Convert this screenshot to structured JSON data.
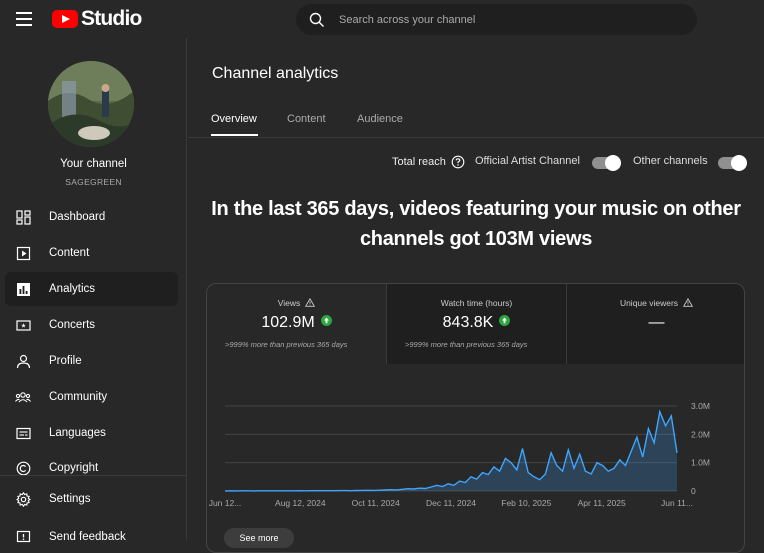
{
  "app": {
    "logo_text": "Studio"
  },
  "search": {
    "placeholder": "Search across your channel"
  },
  "channel": {
    "name": "Your channel",
    "handle": "SAGEGREEN"
  },
  "sidebar": {
    "items": [
      {
        "label": "Dashboard",
        "icon": "dashboard-icon"
      },
      {
        "label": "Content",
        "icon": "content-icon"
      },
      {
        "label": "Analytics",
        "icon": "analytics-icon",
        "active": true
      },
      {
        "label": "Concerts",
        "icon": "ticket-icon"
      },
      {
        "label": "Profile",
        "icon": "profile-icon"
      },
      {
        "label": "Community",
        "icon": "community-icon"
      },
      {
        "label": "Languages",
        "icon": "subtitles-icon"
      },
      {
        "label": "Copyright",
        "icon": "copyright-icon"
      }
    ],
    "settings": "Settings",
    "feedback": "Send feedback"
  },
  "main": {
    "title": "Channel analytics",
    "tabs": [
      "Overview",
      "Content",
      "Audience"
    ],
    "active_tab": "Overview",
    "reach": {
      "label": "Total reach",
      "official": "Official Artist Channel",
      "official_on": true,
      "other": "Other channels",
      "other_on": true
    },
    "headline": "In the last 365 days, videos featuring your music on other channels got 103M views",
    "metrics": [
      {
        "title": "Views",
        "value": "102.9M",
        "trend": "up",
        "sub": ">999% more than previous 365 days"
      },
      {
        "title": "Watch time (hours)",
        "value": "843.8K",
        "trend": "up",
        "sub": ">999% more than previous 365 days"
      },
      {
        "title": "Unique viewers",
        "value": "—"
      }
    ],
    "see_more": "See more"
  },
  "colors": {
    "accent": "#ff0000",
    "line": "#3ea6ff",
    "positive": "#2ba640"
  },
  "chart_data": {
    "type": "line",
    "x_tick_labels": [
      "Jun 12...",
      "Aug 12, 2024",
      "Oct 11, 2024",
      "Dec 11, 2024",
      "Feb 10, 2025",
      "Apr 11, 2025",
      "Jun 11..."
    ],
    "y_tick_labels": [
      "3.0M",
      "2.0M",
      "1.0M",
      "0"
    ],
    "ylim": [
      0,
      3000000
    ],
    "series": [
      {
        "values": [
          5000,
          6000,
          5000,
          7000,
          6000,
          5000,
          6000,
          7000,
          8000,
          6000,
          7000,
          8000,
          7000,
          9000,
          8000,
          10000,
          9000,
          11000,
          12000,
          10000,
          13000,
          15000,
          12000,
          18000,
          20000,
          25000,
          22000,
          30000,
          35000,
          45000,
          40000,
          60000,
          80000,
          70000,
          100000,
          90000,
          140000,
          200000,
          160000,
          250000,
          200000,
          350000,
          300000,
          500000,
          420000,
          650000,
          580000,
          850000,
          700000,
          1150000,
          1000000,
          750000,
          1500000,
          650000,
          500000,
          400000,
          600000,
          1350000,
          900000,
          700000,
          1450000,
          800000,
          1300000,
          700000,
          600000,
          1000000,
          900000,
          700000,
          800000,
          1100000,
          900000,
          1400000,
          1900000,
          1200000,
          2200000,
          1700000,
          2800000,
          2300000,
          2650000,
          1350000
        ]
      }
    ],
    "grid": true
  }
}
